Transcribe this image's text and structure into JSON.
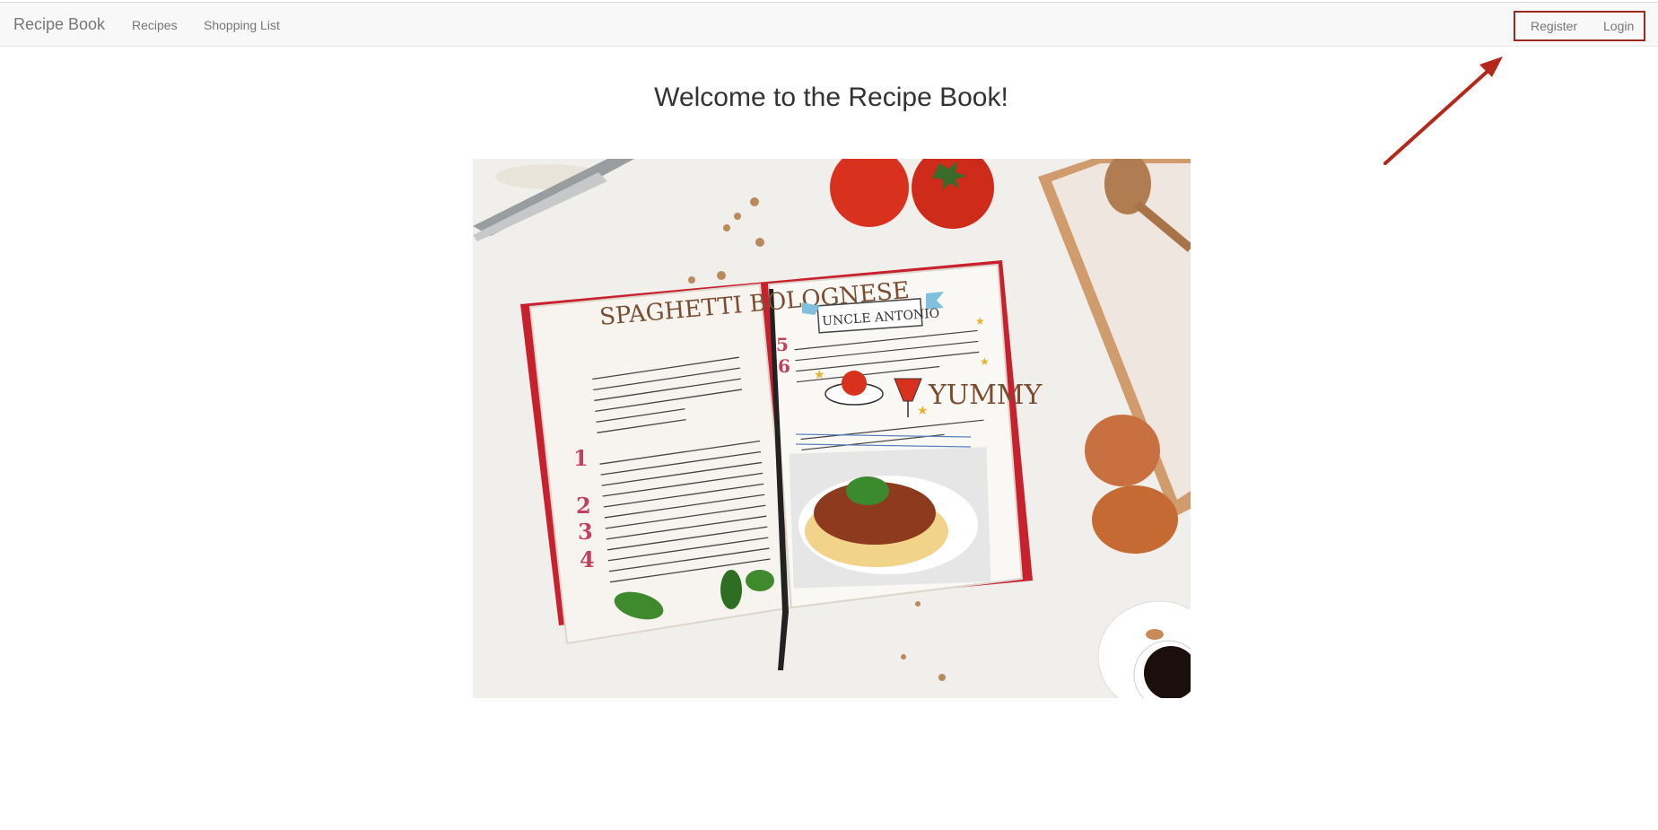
{
  "navbar": {
    "brand": "Recipe Book",
    "links": [
      "Recipes",
      "Shopping List"
    ],
    "auth_links": [
      "Register",
      "Login"
    ],
    "highlight_color": "#9b2a1c"
  },
  "main": {
    "heading": "Welcome to the Recipe Book!",
    "hero_image": {
      "notebook_left_title": "SPAGHETTI BOLOGNESE",
      "notebook_right_title": "UNCLE ANTONIO",
      "notebook_right_caption": "YUMMY",
      "step_numbers": [
        "1",
        "2",
        "3",
        "4",
        "5",
        "6"
      ]
    }
  }
}
